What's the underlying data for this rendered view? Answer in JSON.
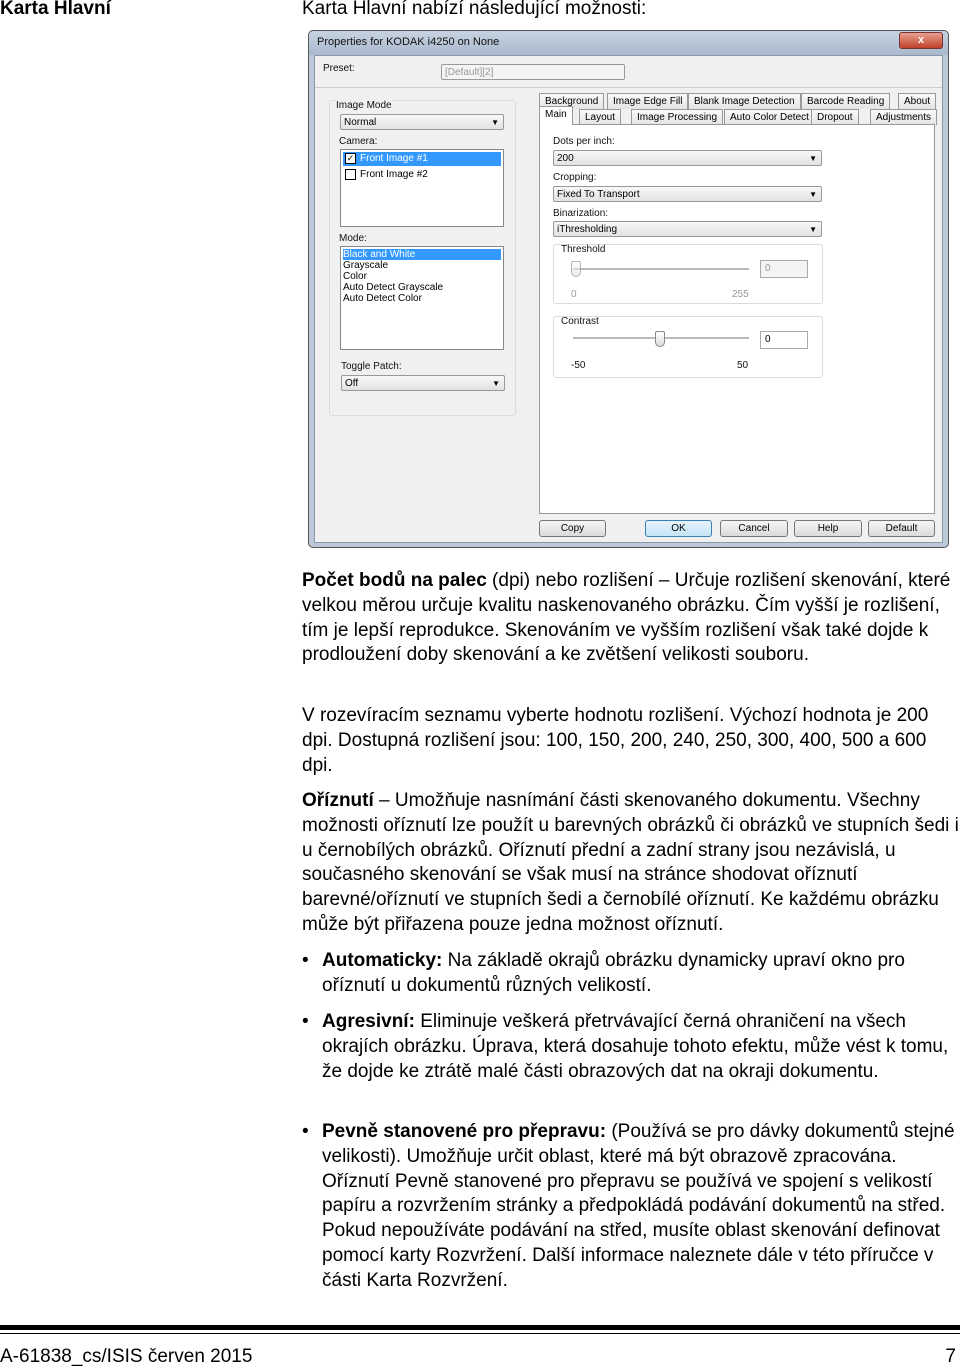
{
  "header": {
    "title": "Karta Hlavní",
    "subtitle": "Karta Hlavní nabízí následující možnosti:"
  },
  "dialog": {
    "title": "Properties for KODAK i4250 on None",
    "close_label": "x",
    "preset_label": "Preset:",
    "preset_value": "[Default][2]",
    "image_mode_label": "Image Mode",
    "image_mode_value": "Normal",
    "camera_label": "Camera:",
    "cameras": [
      {
        "label": "Front Image #1",
        "checked": true,
        "selected": true
      },
      {
        "label": "Front Image #2",
        "checked": false,
        "selected": false
      }
    ],
    "mode_label": "Mode:",
    "modes": [
      "Black and White",
      "Grayscale",
      "Color",
      "Auto Detect Grayscale",
      "Auto Detect Color"
    ],
    "mode_selected": "Black and White",
    "toggle_patch_label": "Toggle Patch:",
    "toggle_patch_value": "Off",
    "tabs_row1": [
      "Background",
      "Image Edge Fill",
      "Blank Image Detection",
      "Barcode Reading",
      "About"
    ],
    "tabs_row2": [
      "Main",
      "Layout",
      "Image Processing",
      "Auto Color Detect",
      "Dropout",
      "Adjustments"
    ],
    "active_tab": "Main",
    "dpi_label": "Dots per inch:",
    "dpi_value": "200",
    "cropping_label": "Cropping:",
    "cropping_value": "Fixed To Transport",
    "binarization_label": "Binarization:",
    "binarization_value": "iThresholding",
    "threshold": {
      "label": "Threshold",
      "value": "0",
      "min": "0",
      "max": "255",
      "enabled": false
    },
    "contrast": {
      "label": "Contrast",
      "value": "0",
      "min": "-50",
      "max": "50"
    },
    "buttons": {
      "copy": "Copy",
      "ok": "OK",
      "cancel": "Cancel",
      "help": "Help",
      "default": "Default"
    }
  },
  "body": {
    "p1_bold": "Počet bodů na palec",
    "p1_text": " (dpi) nebo rozlišení – Určuje rozlišení skenování, které velkou měrou určuje kvalitu naskenovaného obrázku. Čím vyšší je rozlišení, tím je lepší reprodukce. Skenováním ve vyšším rozlišení však také dojde k prodloužení doby skenování a ke zvětšení velikosti souboru.",
    "p2": "V rozevíracím seznamu vyberte hodnotu rozlišení. Výchozí hodnota je 200 dpi. Dostupná rozlišení jsou: 100, 150, 200, 240, 250, 300, 400, 500 a 600 dpi.",
    "p3_bold": "Oříznutí",
    "p3_text": " – Umožňuje nasnímání části skenovaného dokumentu. Všechny možnosti oříznutí lze použít u barevných obrázků či obrázků ve stupních šedi i u černobílých obrázků. Oříznutí přední a zadní strany jsou nezávislá, u současného skenování se však musí na stránce shodovat oříznutí barevné/oříznutí ve stupních šedi a černobílé oříznutí. Ke každému obrázku může být přiřazena pouze jedna možnost oříznutí.",
    "bullet": "•",
    "bullets": [
      {
        "bold": "Automaticky:",
        "text": " Na základě okrajů obrázku dynamicky upraví okno pro oříznutí u dokumentů různých velikostí."
      },
      {
        "bold": "Agresivní:",
        "text": " Eliminuje veškerá přetrvávající černá ohraničení na všech okrajích obrázku. Úprava, která dosahuje tohoto efektu, může vést k tomu, že dojde ke ztrátě malé části obrazových dat na okraji dokumentu."
      },
      {
        "bold": "Pevně stanovené pro přepravu:",
        "text": " (Používá se pro dávky dokumentů stejné velikosti). Umožňuje určit oblast, které má být obrazově zpracována. Oříznutí Pevně stanovené pro přepravu se používá ve spojení s velikostí papíru a rozvržením stránky a předpokládá podávání dokumentů na střed. Pokud nepoužíváte podávání na střed, musíte oblast skenování definovat pomocí karty Rozvržení. Další informace naleznete dále v této příručce v části Karta Rozvržení."
      }
    ]
  },
  "footer": {
    "doc_id": "A-61838_cs/ISIS  červen 2015",
    "page": "7"
  }
}
